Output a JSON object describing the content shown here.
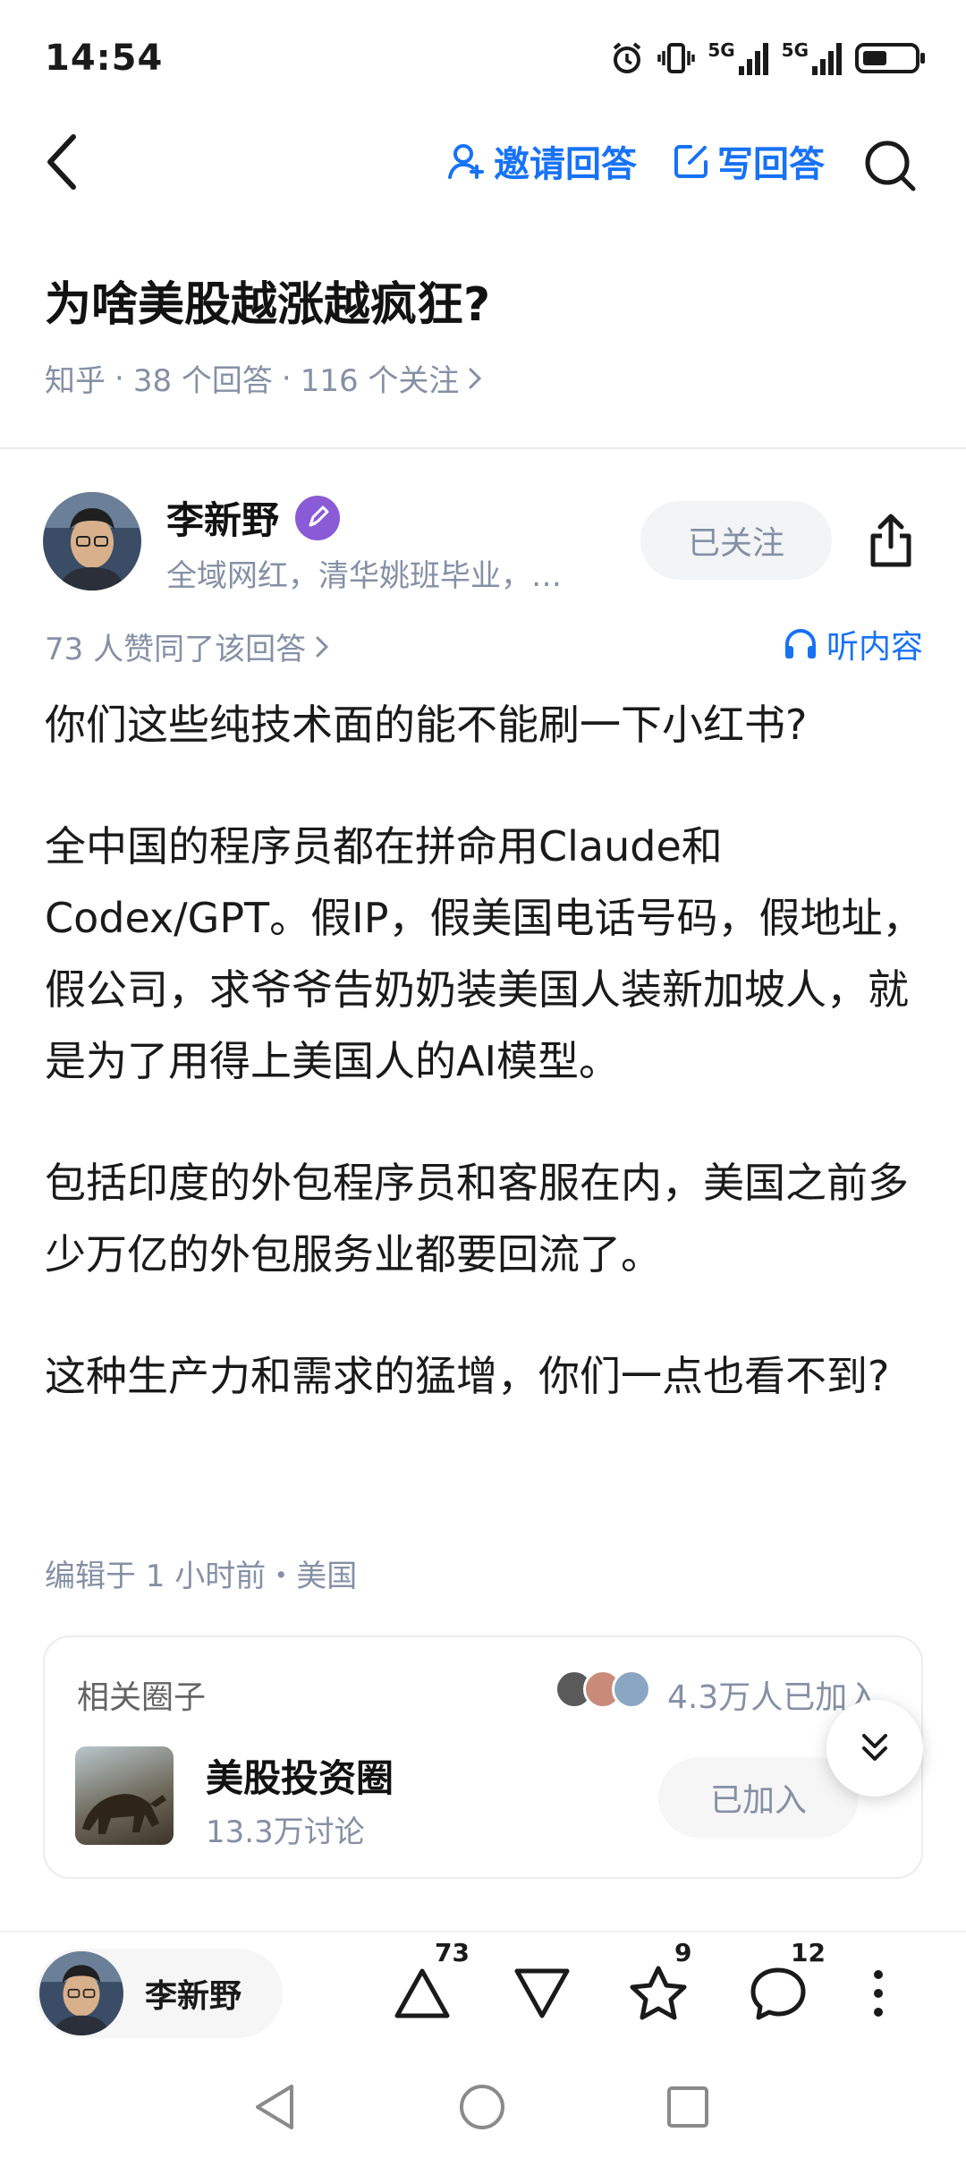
{
  "status_bar": {
    "time": "14:54",
    "signal_1": "5G",
    "signal_2": "5G"
  },
  "nav": {
    "invite_label": "邀请回答",
    "write_label": "写回答"
  },
  "question": {
    "title": "为啥美股越涨越疯狂?",
    "source": "知乎",
    "answers": "38 个回答",
    "followers": "116 个关注"
  },
  "author": {
    "name": "李新野",
    "bio": "全域网红，清华姚班毕业，…",
    "follow_label": "已关注"
  },
  "answer": {
    "likes_text": "73 人赞同了该回答",
    "listen_label": "听内容",
    "paragraphs": [
      "你们这些纯技术面的能不能刷一下小红书?",
      "全中国的程序员都在拼命用Claude和Codex/GPT。假IP，假美国电话号码，假地址，假公司，求爷爷告奶奶装美国人装新加坡人，就是为了用得上美国人的AI模型。",
      "包括印度的外包程序员和客服在内，美国之前多少万亿的外包服务业都要回流了。",
      "这种生产力和需求的猛增，你们一点也看不到?"
    ],
    "edit_meta": "编辑于 1 小时前・美国"
  },
  "circle": {
    "section_label": "相关圈子",
    "member_count": "4.3万人已加入",
    "name": "美股投资圈",
    "discussions": "13.3万讨论",
    "joined_label": "已加入"
  },
  "bottom_bar": {
    "author_name": "李新野",
    "upvote_count": "73",
    "favorite_count": "9",
    "comment_count": "12"
  },
  "colors": {
    "accent": "#1772f6",
    "muted": "#8590a6",
    "badge": "#8a5bd6"
  },
  "icons": [
    "back-icon",
    "invite-icon",
    "edit-icon",
    "search-icon",
    "verified-badge-icon",
    "share-icon",
    "headphones-icon",
    "collapse-icon",
    "upvote-icon",
    "downvote-icon",
    "star-icon",
    "comment-icon",
    "more-icon",
    "nav-back-icon",
    "nav-home-icon",
    "nav-recents-icon"
  ]
}
